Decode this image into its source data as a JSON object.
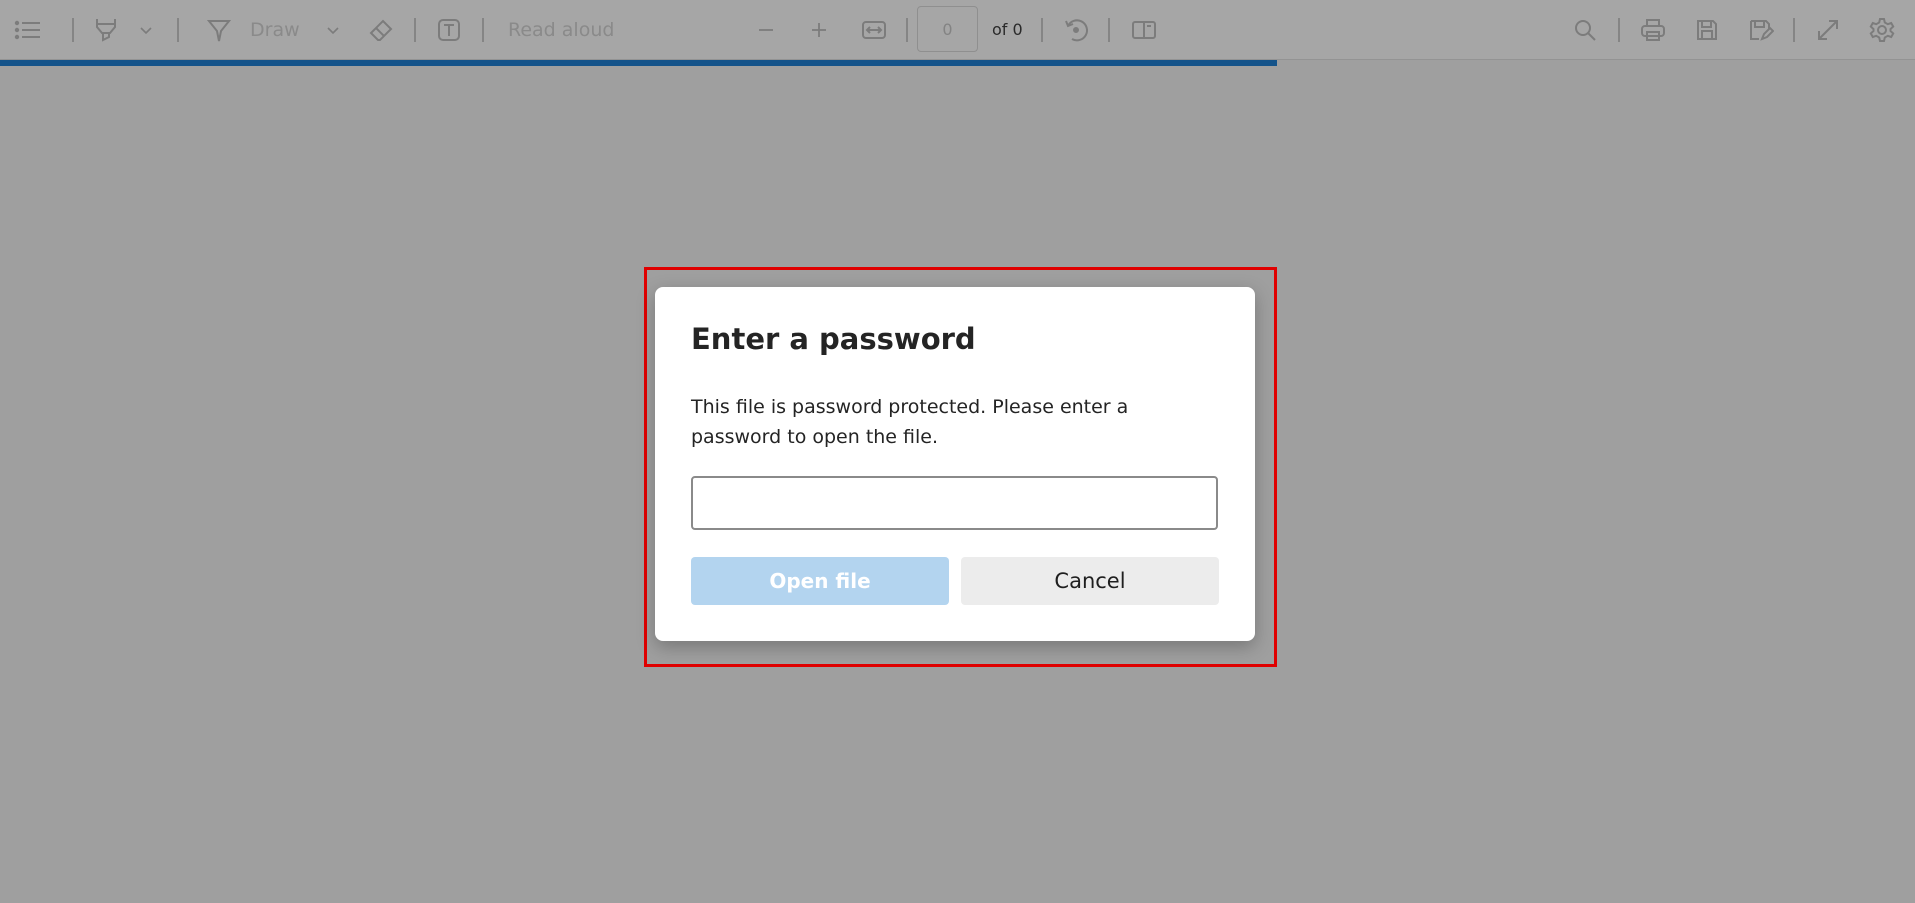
{
  "toolbar": {
    "draw_label": "Draw",
    "read_aloud_label": "Read aloud",
    "page_number_value": "0",
    "page_count_text": "of 0"
  },
  "loading_progress": 0.667,
  "colors": {
    "progress": "#14538a",
    "highlight_border": "#e00000",
    "open_button_bg": "#b3d4ef",
    "cancel_button_bg": "#ececec"
  },
  "icons": {
    "contents": "list-icon",
    "highlight": "highlighter-icon",
    "highlight_menu": "chevron-down-icon",
    "draw": "pen-icon",
    "draw_menu": "chevron-down-icon",
    "erase": "eraser-icon",
    "text": "text-box-icon",
    "zoom_out": "minus-icon",
    "zoom_in": "plus-icon",
    "fit": "fit-width-icon",
    "rotate": "rotate-icon",
    "page_view": "page-view-icon",
    "search": "search-icon",
    "print": "print-icon",
    "save": "save-icon",
    "save_as": "save-as-icon",
    "fullscreen": "expand-icon",
    "settings": "gear-icon"
  },
  "dialog": {
    "title": "Enter a password",
    "message": "This file is password protected. Please enter a password to open the file.",
    "password_value": "",
    "open_button": "Open file",
    "cancel_button": "Cancel"
  }
}
